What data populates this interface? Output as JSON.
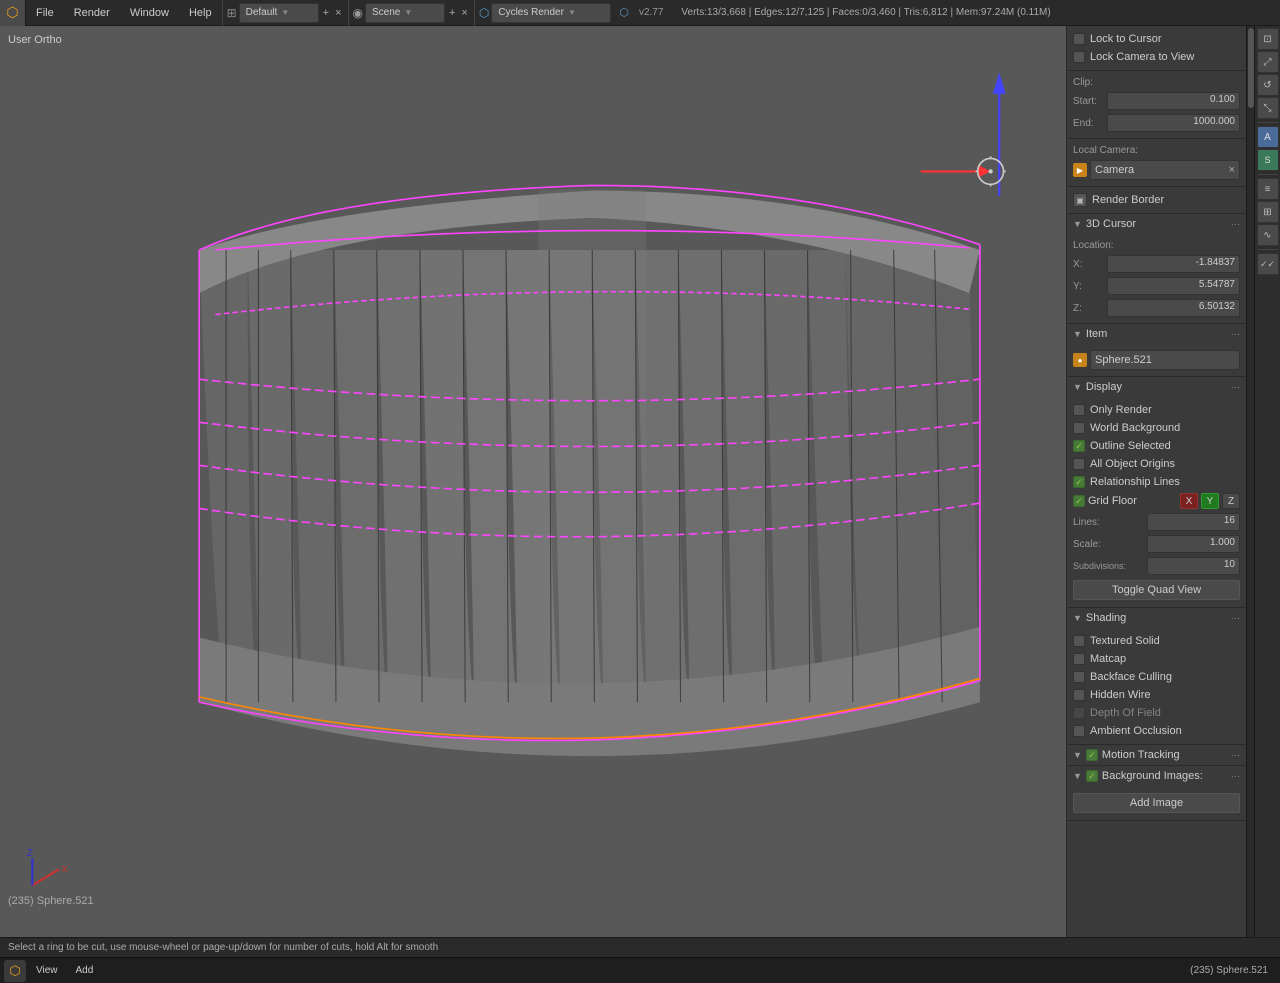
{
  "topbar": {
    "blender_icon": "⬡",
    "menus": [
      "File",
      "Render",
      "Window",
      "Help"
    ],
    "workspace_icon": "⊞",
    "workspace_name": "Default",
    "add_workspace": "+",
    "close_workspace": "×",
    "scene_icon": "◉",
    "scene_name": "Scene",
    "scene_add": "+",
    "scene_close": "×",
    "render_engine": "Cycles Render",
    "render_arrow": "▼",
    "blender_icon2": "⬡",
    "version_info": "v2.77",
    "stats": "Verts:13/3,668  |  Edges:12/7,125  |  Faces:0/3,460  |  Tris:6,812  |  Mem:97.24M (0.11M)"
  },
  "viewport": {
    "label": "User Ortho"
  },
  "right_panel": {
    "lock_to_cursor": {
      "label": "Lock to Cursor",
      "checked": false
    },
    "lock_camera_to_view": {
      "label": "Lock Camera to View",
      "checked": false
    },
    "clip": {
      "label": "Clip:",
      "start_label": "Start:",
      "start_value": "0.100",
      "end_label": "End:",
      "end_value": "1000.000"
    },
    "local_camera": {
      "label": "Local Camera:",
      "cam_label": "Camera",
      "close": "×"
    },
    "render_border": {
      "label": "Render Border"
    },
    "cursor_3d": {
      "title": "3D Cursor",
      "location_label": "Location:",
      "x_label": "X:",
      "x_value": "-1.84837",
      "y_label": "Y:",
      "y_value": "5.54787",
      "z_label": "Z:",
      "z_value": "6.50132"
    },
    "item": {
      "title": "Item",
      "icon": "●",
      "name_value": "Sphere.521"
    },
    "display": {
      "title": "Display",
      "only_render": {
        "label": "Only Render",
        "checked": false
      },
      "world_background": {
        "label": "World Background",
        "checked": false
      },
      "outline_selected": {
        "label": "Outline Selected",
        "checked": true
      },
      "all_object_origins": {
        "label": "All Object Origins",
        "checked": false
      },
      "relationship_lines": {
        "label": "Relationship Lines",
        "checked": true
      },
      "grid_floor": {
        "label": "Grid Floor",
        "checked": true,
        "x_label": "X",
        "y_label": "Y",
        "z_label": "Z"
      },
      "lines_label": "Lines:",
      "lines_value": "16",
      "scale_label": "Scale:",
      "scale_value": "1.000",
      "subdivisions_label": "Subdivisions:",
      "subdivisions_value": "10",
      "toggle_quad_view": "Toggle Quad View"
    },
    "shading": {
      "title": "Shading",
      "textured_solid": {
        "label": "Textured Solid",
        "checked": false
      },
      "matcap": {
        "label": "Matcap",
        "checked": false
      },
      "backface_culling": {
        "label": "Backface Culling",
        "checked": false
      },
      "hidden_wire": {
        "label": "Hidden Wire",
        "checked": false
      },
      "depth_of_field": {
        "label": "Depth Of Field",
        "checked": false
      },
      "ambient_occlusion": {
        "label": "Ambient Occlusion",
        "checked": false
      }
    },
    "motion_tracking": {
      "title": "Motion Tracking",
      "checked": true
    },
    "background_images": {
      "title": "Background Images:",
      "checked": true,
      "add_image_btn": "Add Image"
    }
  },
  "status_bar": {
    "message": "Select a ring to be cut, use mouse-wheel or page-up/down for number of cuts, hold Alt for smooth"
  },
  "taskbar": {
    "view_label": "View",
    "add_label": "Add",
    "object_info": "(235) Sphere.521"
  },
  "far_right": {
    "buttons": [
      "≡",
      "↔",
      "⤢",
      "⤡",
      "∿",
      "□",
      "▷",
      "⊡",
      "A",
      "S"
    ]
  }
}
